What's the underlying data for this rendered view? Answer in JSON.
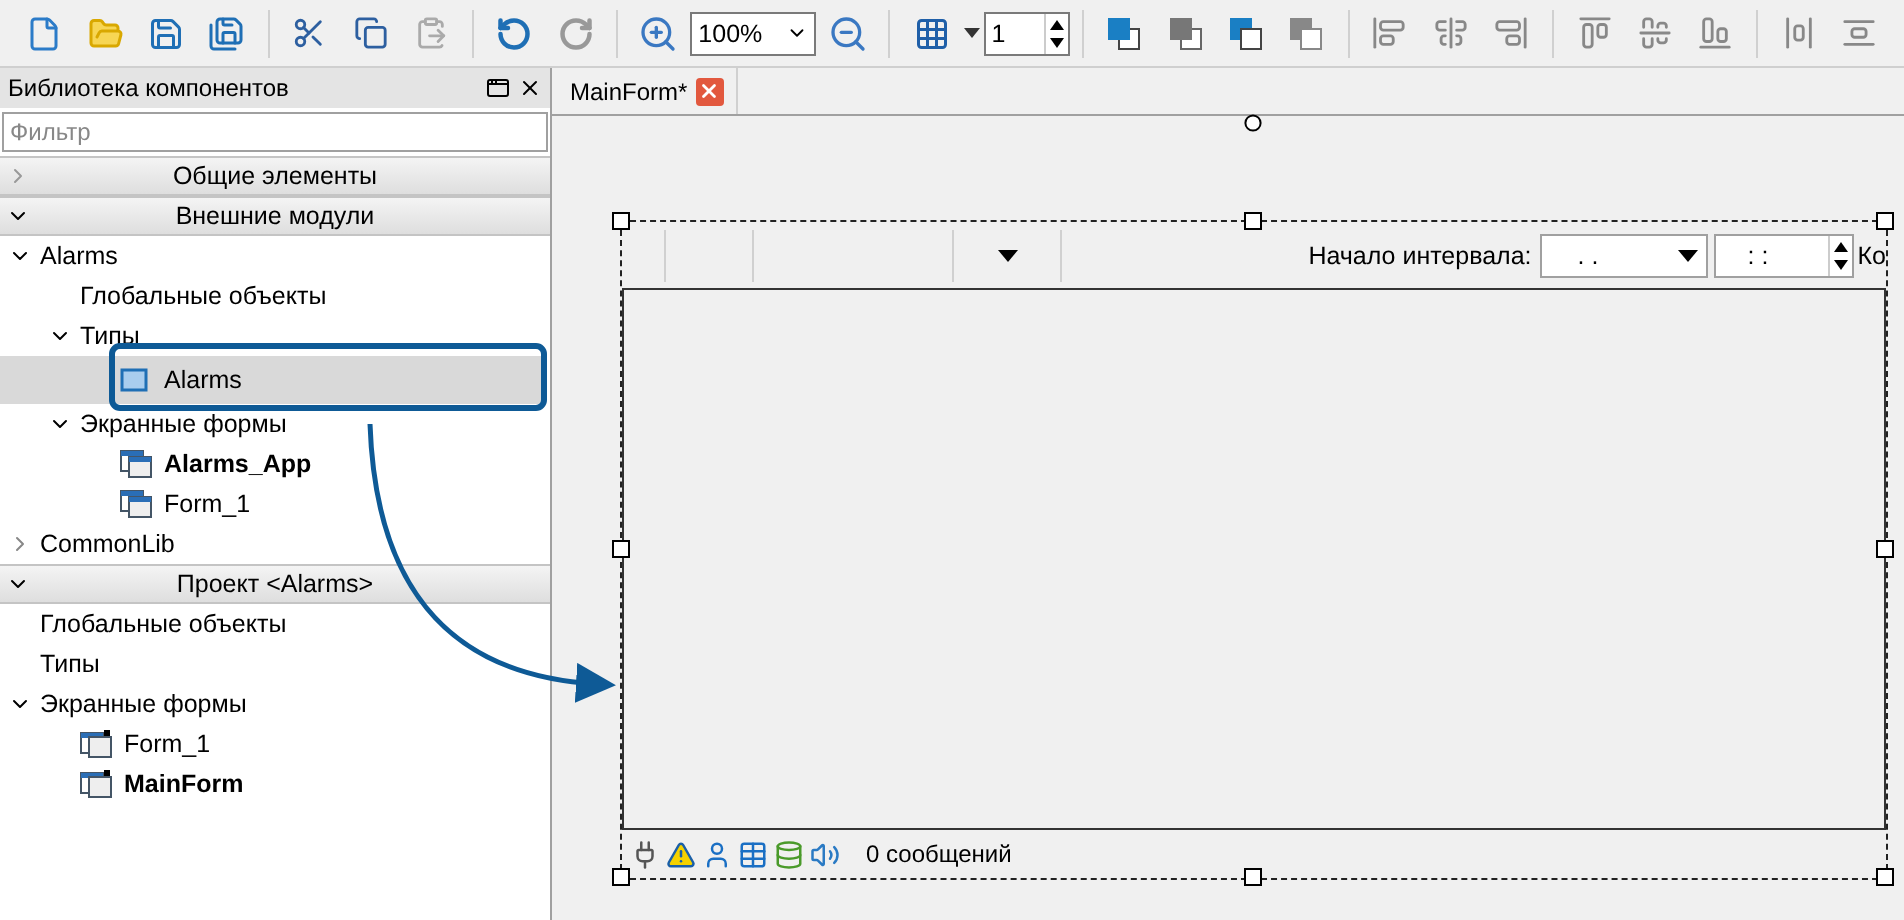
{
  "toolbar": {
    "zoom": "100%",
    "grid_step": "1"
  },
  "library": {
    "title": "Библиотека компонентов",
    "filter": {
      "placeholder": "Фильтр"
    },
    "sections": [
      {
        "title": "Общие элементы",
        "expanded": false
      },
      {
        "title": "Внешние модули",
        "expanded": true,
        "items": [
          {
            "label": "Alarms",
            "kind": "folder",
            "expanded": true,
            "selected": false,
            "bold": false,
            "children": [
              {
                "label": "Глобальные объекты",
                "kind": "leaf",
                "selected": false,
                "bold": false
              },
              {
                "label": "Типы",
                "kind": "folder",
                "expanded": true,
                "selected": false,
                "bold": false,
                "children": [
                  {
                    "label": "Alarms",
                    "kind": "type",
                    "selected": true,
                    "bold": false
                  }
                ]
              },
              {
                "label": "Экранные формы",
                "kind": "folder",
                "expanded": true,
                "selected": false,
                "bold": false,
                "children": [
                  {
                    "label": "Alarms_App",
                    "kind": "form",
                    "selected": false,
                    "bold": true
                  },
                  {
                    "label": "Form_1",
                    "kind": "form",
                    "selected": false,
                    "bold": false
                  }
                ]
              }
            ]
          },
          {
            "label": "CommonLib",
            "kind": "folder",
            "expanded": false,
            "selected": false,
            "bold": false
          }
        ]
      },
      {
        "title": "Проект <Alarms>",
        "expanded": true,
        "items": [
          {
            "label": "Глобальные объекты",
            "kind": "leaf",
            "selected": false,
            "bold": false
          },
          {
            "label": "Типы",
            "kind": "leaf",
            "selected": false,
            "bold": false
          },
          {
            "label": "Экранные формы",
            "kind": "folder",
            "expanded": true,
            "selected": false,
            "bold": false,
            "children": [
              {
                "label": "Form_1",
                "kind": "project-form",
                "selected": false,
                "bold": false
              },
              {
                "label": "MainForm",
                "kind": "project-form",
                "selected": false,
                "bold": true
              }
            ]
          }
        ]
      }
    ]
  },
  "editor": {
    "tabs": [
      {
        "label": "MainForm*",
        "selected": true
      }
    ],
    "widget": {
      "interval_label": "Начало интервала:",
      "date_value": ".   .",
      "time_value": ":   :",
      "cut_label": "Ко",
      "status": "0 сообщений"
    }
  }
}
